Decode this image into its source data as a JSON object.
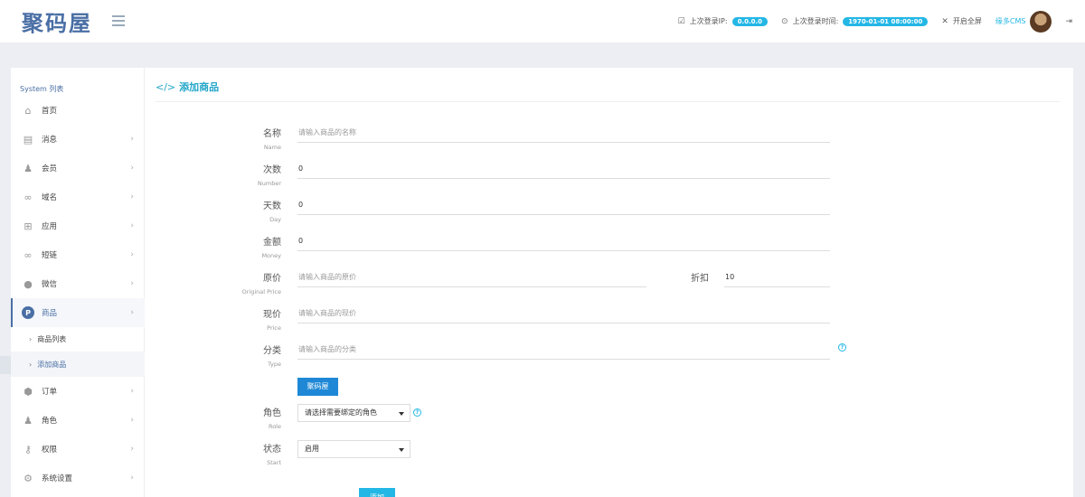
{
  "header": {
    "logo": "聚码屋",
    "last_ip_label": "上次登录IP:",
    "last_ip": "0.0.0.0",
    "last_time_label": "上次登录时间:",
    "last_time": "1970-01-01 08:00:00",
    "fullscreen": "开启全屏",
    "cms_link": "缘多CMS"
  },
  "sidebar": {
    "title": "System 列表",
    "items": [
      {
        "label": "首页",
        "icon": "home-icon",
        "chevron": ""
      },
      {
        "label": "消息",
        "icon": "file-icon",
        "chevron": "›"
      },
      {
        "label": "会员",
        "icon": "user-icon",
        "chevron": "›"
      },
      {
        "label": "域名",
        "icon": "link-icon",
        "chevron": "›"
      },
      {
        "label": "应用",
        "icon": "gift-icon",
        "chevron": "›"
      },
      {
        "label": "短链",
        "icon": "link-icon",
        "chevron": "›"
      },
      {
        "label": "微信",
        "icon": "wechat-icon",
        "chevron": "›"
      },
      {
        "label": "商品",
        "icon": "product-icon",
        "chevron": "›",
        "active": true,
        "badge": "P"
      },
      {
        "label": "订单",
        "icon": "order-icon",
        "chevron": "›"
      },
      {
        "label": "角色",
        "icon": "role-icon",
        "chevron": "›"
      },
      {
        "label": "权限",
        "icon": "key-icon",
        "chevron": "›"
      },
      {
        "label": "系统设置",
        "icon": "settings-icon",
        "chevron": "›"
      }
    ],
    "sub_items": [
      {
        "label": "商品列表"
      },
      {
        "label": "添加商品",
        "active": true
      }
    ]
  },
  "content": {
    "title": "添加商品",
    "title_icon": "</>"
  },
  "form": {
    "name": {
      "label": "名称",
      "en": "Name",
      "placeholder": "请输入商品的名称"
    },
    "number": {
      "label": "次数",
      "en": "Number",
      "value": "0"
    },
    "day": {
      "label": "天数",
      "en": "Day",
      "value": "0"
    },
    "money": {
      "label": "金额",
      "en": "Money",
      "value": "0"
    },
    "original_price": {
      "label": "原价",
      "en": "Original Price",
      "placeholder": "请输入商品的原价"
    },
    "discount": {
      "label": "折扣",
      "value": "10"
    },
    "price": {
      "label": "现价",
      "en": "Price",
      "placeholder": "请输入商品的现价"
    },
    "type": {
      "label": "分类",
      "en": "Type",
      "placeholder": "请输入商品的分类",
      "tag_button": "聚码屋"
    },
    "role": {
      "label": "角色",
      "en": "Role",
      "selected": "请选择需要绑定的角色"
    },
    "status": {
      "label": "状态",
      "en": "Start",
      "selected": "启用"
    },
    "submit": "添加",
    "help_mark": "?"
  },
  "colors": {
    "accent": "#23b7e5",
    "brand": "#4a6fa5",
    "button": "#1e88d6"
  }
}
